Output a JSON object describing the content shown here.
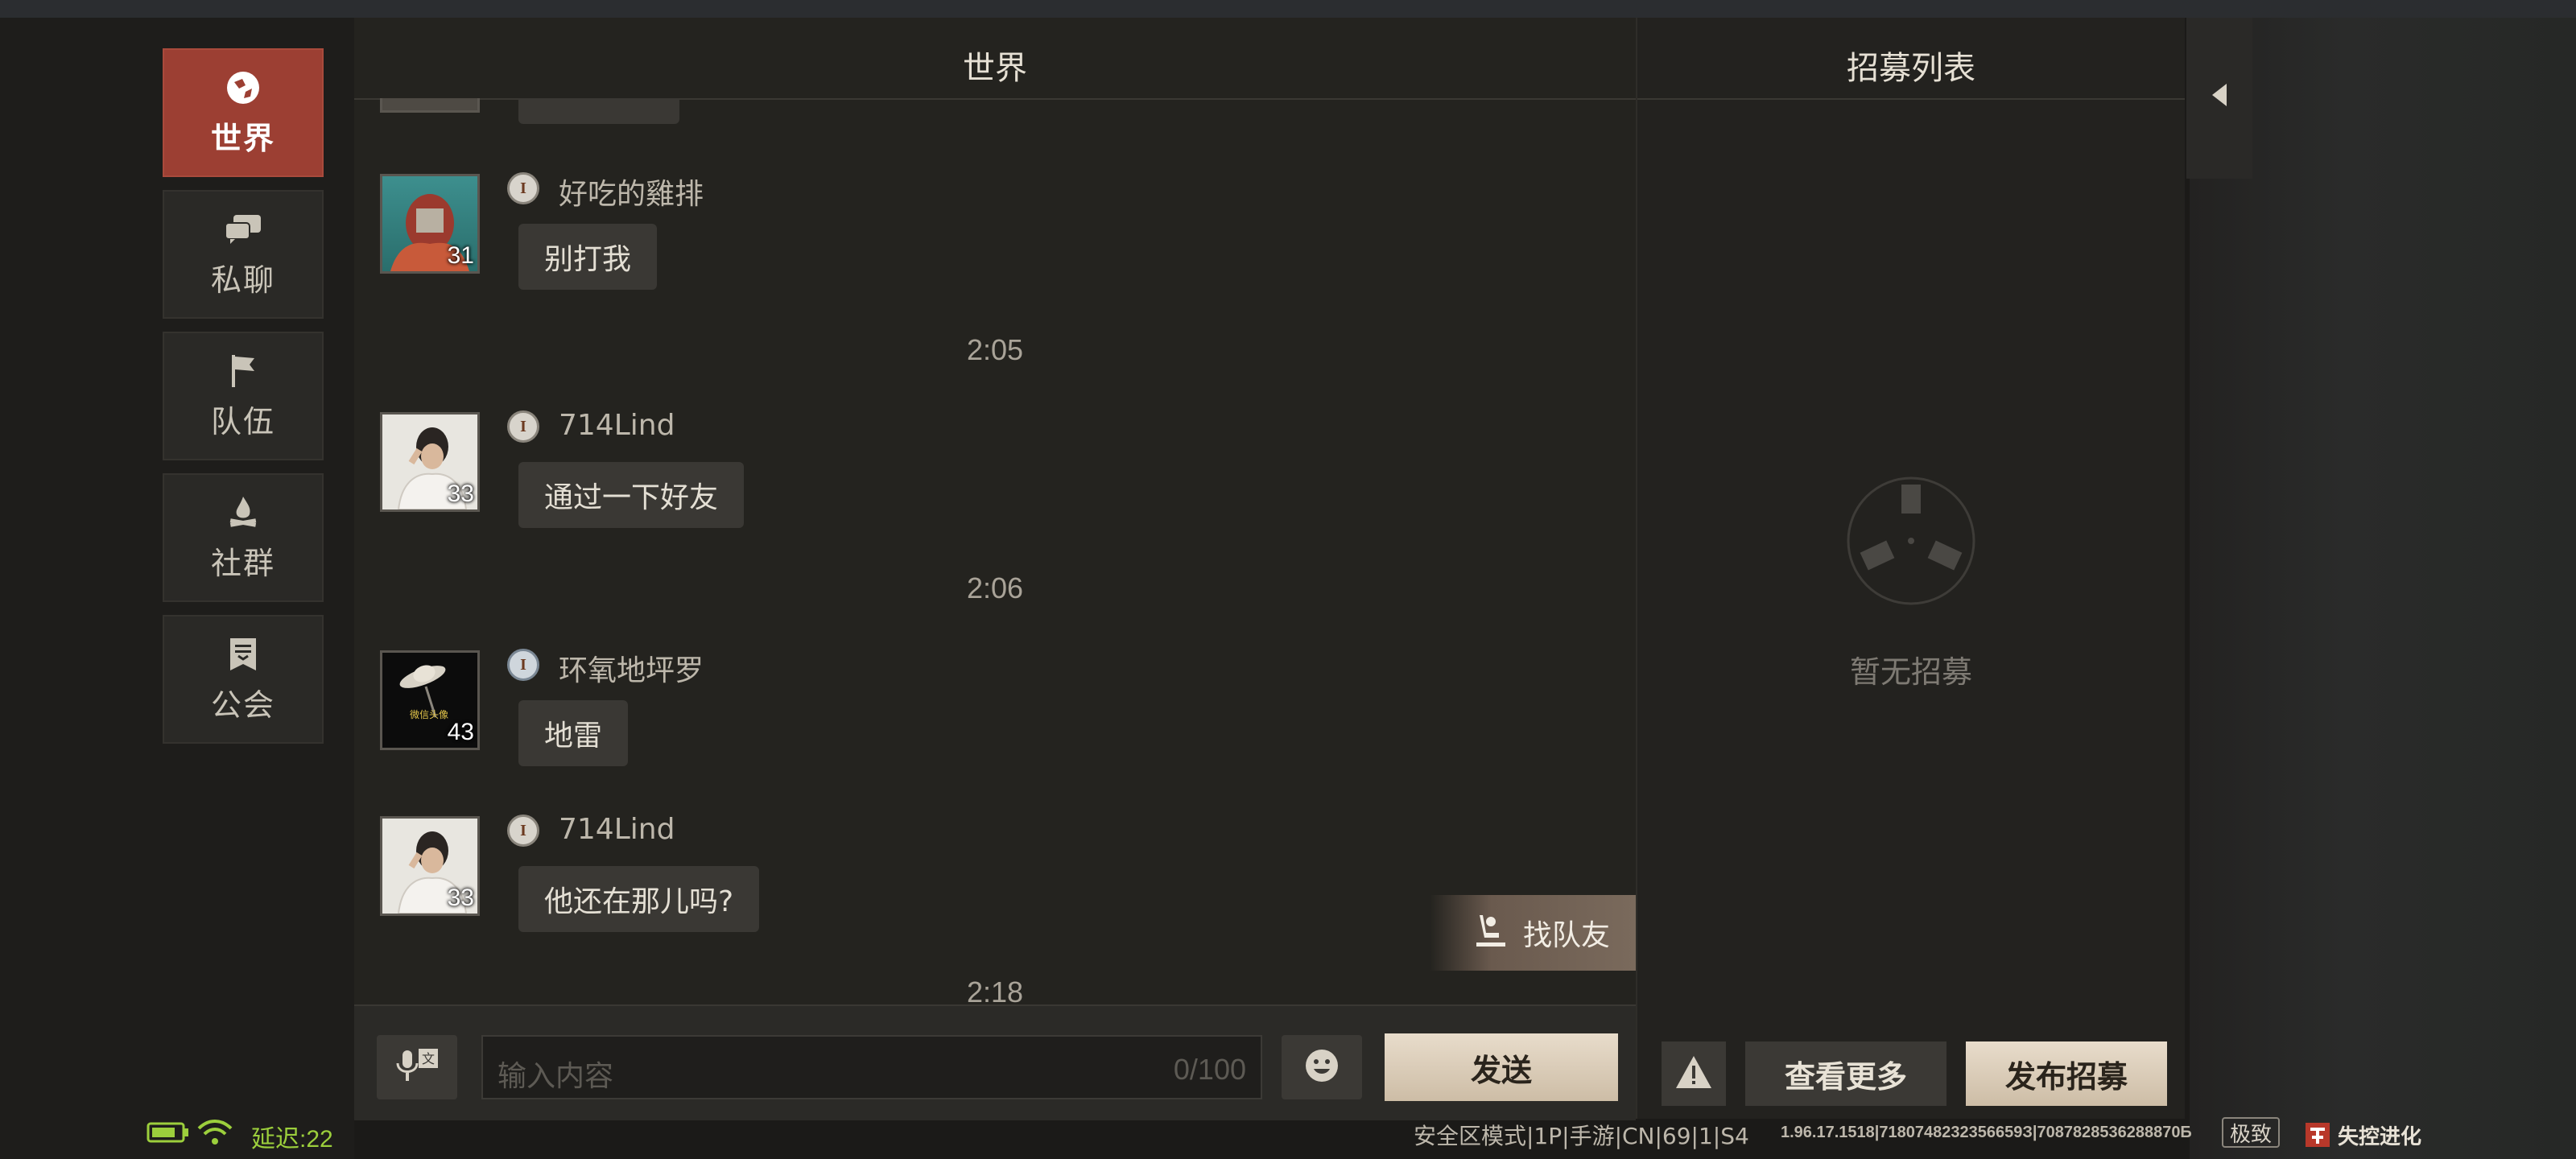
{
  "sidebar": {
    "tabs": [
      {
        "label": "世界",
        "icon": "globe-icon",
        "active": true
      },
      {
        "label": "私聊",
        "icon": "chat-bubbles-icon",
        "active": false
      },
      {
        "label": "队伍",
        "icon": "flag-icon",
        "active": false
      },
      {
        "label": "社群",
        "icon": "campfire-icon",
        "active": false
      },
      {
        "label": "公会",
        "icon": "banner-icon",
        "active": false
      }
    ]
  },
  "chat": {
    "title": "世界",
    "messages": [
      {
        "name": "好吃的雞排",
        "level": "31",
        "text": "别打我"
      },
      {
        "time": "2:05"
      },
      {
        "name": "714Lind",
        "level": "33",
        "text": "通过一下好友"
      },
      {
        "time": "2:06"
      },
      {
        "name": "环氧地坪罗",
        "level": "43",
        "text": "地雷"
      },
      {
        "name": "714Lind",
        "level": "33",
        "text": "他还在那儿吗?"
      },
      {
        "time": "2:18"
      }
    ],
    "find_team_label": "找队友",
    "avatar3_caption": "微信头像"
  },
  "input": {
    "placeholder": "输入内容",
    "counter": "0/100",
    "send_label": "发送"
  },
  "recruit": {
    "title": "招募列表",
    "empty_text": "暂无招募",
    "more_label": "查看更多",
    "publish_label": "发布招募"
  },
  "status": {
    "delay": "延迟:22",
    "mode": "安全区模式|1P|手游|CN|69|1|S4",
    "version": "1.96.17.1518|7180748232356659З|7087828536288870Б",
    "quality": "极致",
    "logo_text": "失控进化"
  },
  "colors": {
    "active_tab": "#9c3f33",
    "delay_green": "#9ccf3c",
    "button_light": "#e8dccb"
  }
}
